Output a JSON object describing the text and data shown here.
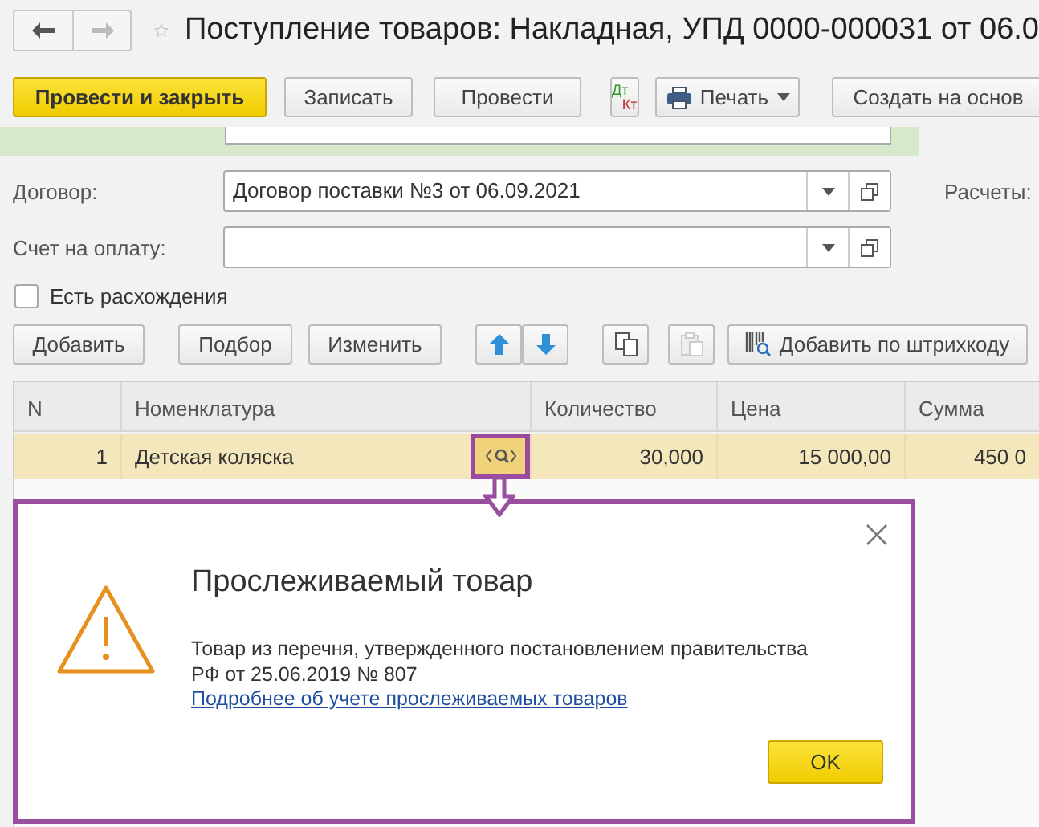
{
  "window": {
    "title": "Поступление товаров: Накладная, УПД 0000-000031 от 06.0"
  },
  "toolbar": [
    {
      "kind": "primary",
      "label": "Провести и закрыть"
    },
    {
      "kind": "plain",
      "label": "Записать"
    },
    {
      "kind": "plain",
      "label": "Провести"
    },
    {
      "kind": "dtkt",
      "top": "Дт",
      "bottom": "Кт"
    },
    {
      "kind": "print",
      "label": "Печать"
    },
    {
      "kind": "plain",
      "label": "Создать на основ"
    }
  ],
  "fields": [
    {
      "label": "Договор:",
      "value": "Договор поставки №3 от 06.09.2021"
    },
    {
      "label": "Счет на оплату:"
    }
  ],
  "side_label": "Расчеты:",
  "discrepancy": {
    "label": "Есть расхождения",
    "checked": false
  },
  "table_toolbar": [
    {
      "kind": "text",
      "label": "Добавить",
      "disabled": false
    },
    {
      "kind": "text",
      "label": "Подбор",
      "disabled": false
    },
    {
      "kind": "text",
      "label": "Изменить",
      "disabled": false
    },
    {
      "kind": "up",
      "disabled": false
    },
    {
      "kind": "down",
      "disabled": false
    },
    {
      "kind": "copy",
      "disabled": false
    },
    {
      "kind": "paste",
      "disabled": true
    },
    {
      "kind": "barcode",
      "label": "Добавить по штрихкоду",
      "disabled": false
    }
  ],
  "table": {
    "columns": [
      "N",
      "Номенклатура",
      "Количество",
      "Цена",
      "Сумма"
    ],
    "rows": [
      {
        "n": "1",
        "name": "Детская коляска",
        "quantity": "30,000",
        "price": "15 000,00",
        "sum": "450 0",
        "selected": true,
        "tracked": true
      }
    ]
  },
  "popup": {
    "title": "Прослеживаемый товар",
    "message": "Товар из перечня, утвержденного постановлением правительства РФ от 25.06.2019 № 807",
    "link": "Подробнее об учете прослеживаемых товаров",
    "ok": "OK"
  }
}
